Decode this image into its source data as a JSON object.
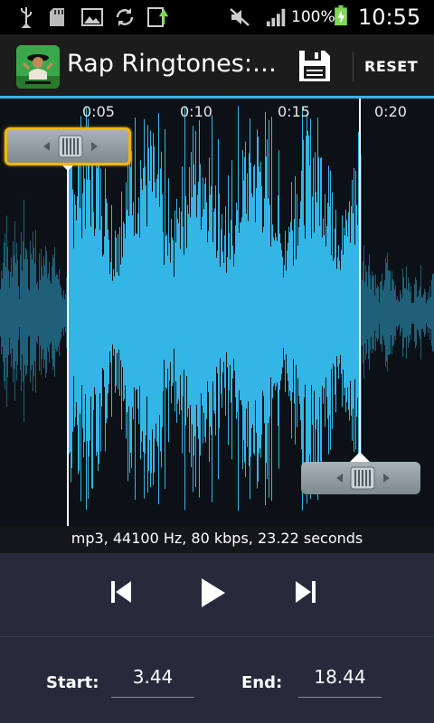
{
  "status_bar": {
    "battery_percent": "100%",
    "time": "10:55",
    "icons": [
      "usb-icon",
      "sd-card-icon",
      "image-icon",
      "sync-icon",
      "download-icon",
      "mute-icon",
      "signal-icon",
      "battery-charging-icon"
    ]
  },
  "action_bar": {
    "title": "Rap Ringtones:…",
    "app_icon": "rapper-app-icon",
    "save_icon": "save-floppy-icon",
    "reset_label": "RESET"
  },
  "waveform": {
    "time_labels": [
      "0:05",
      "0:10",
      "0:15",
      "0:20"
    ],
    "start_handle_icon": "drag-handle-icon",
    "end_handle_icon": "drag-handle-icon",
    "colors": {
      "selected": "#33b5e5",
      "unselected": "#1f5f78",
      "background": "#0b1116",
      "focus": "#f2b705"
    }
  },
  "info": "mp3, 44100 Hz, 80 kbps, 23.22 seconds",
  "controls": {
    "prev_icon": "skip-back-icon",
    "play_icon": "play-icon",
    "next_icon": "skip-forward-icon"
  },
  "range": {
    "start_label": "Start:",
    "start_value": "3.44",
    "end_label": "End:",
    "end_value": "18.44"
  }
}
